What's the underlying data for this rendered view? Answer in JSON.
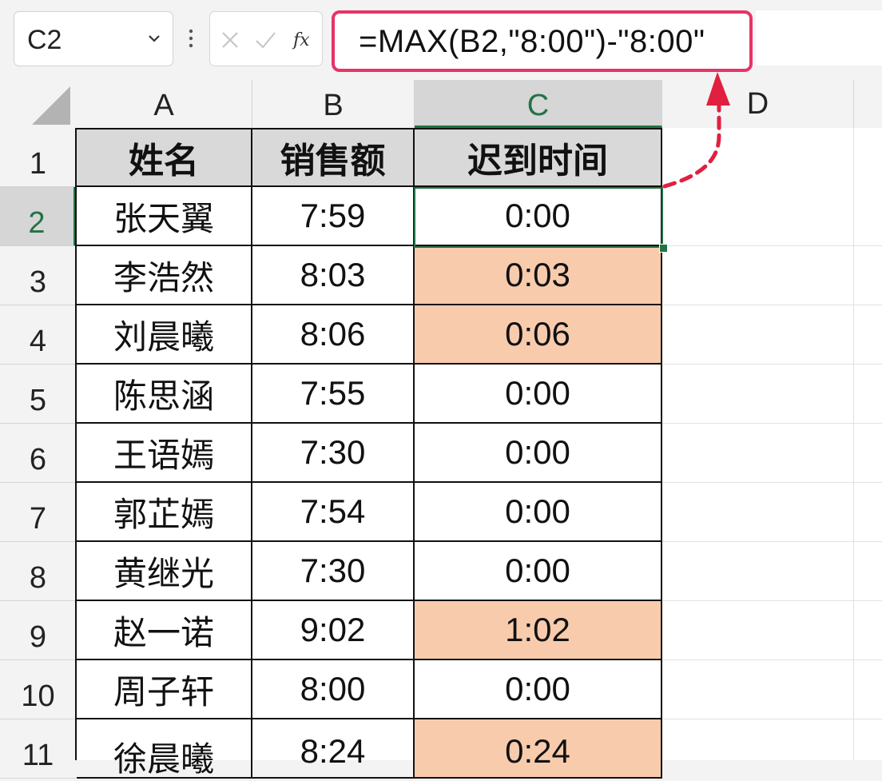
{
  "formula_bar": {
    "name_box": "C2",
    "formula": "=MAX(B2,\"8:00\")-\"8:00\""
  },
  "columns": [
    "A",
    "B",
    "C",
    "D"
  ],
  "rows": [
    "1",
    "2",
    "3",
    "4",
    "5",
    "6",
    "7",
    "8",
    "9",
    "10",
    "11"
  ],
  "table": {
    "headers": [
      "姓名",
      "销售额",
      "迟到时间"
    ],
    "rows": [
      {
        "name": "张天翼",
        "time": "7:59",
        "late": "0:00"
      },
      {
        "name": "李浩然",
        "time": "8:03",
        "late": "0:03"
      },
      {
        "name": "刘晨曦",
        "time": "8:06",
        "late": "0:06"
      },
      {
        "name": "陈思涵",
        "time": "7:55",
        "late": "0:00"
      },
      {
        "name": "王语嫣",
        "time": "7:30",
        "late": "0:00"
      },
      {
        "name": "郭芷嫣",
        "time": "7:54",
        "late": "0:00"
      },
      {
        "name": "黄继光",
        "time": "7:30",
        "late": "0:00"
      },
      {
        "name": "赵一诺",
        "time": "9:02",
        "late": "1:02"
      },
      {
        "name": "周子轩",
        "time": "8:00",
        "late": "0:00"
      },
      {
        "name": "徐晨曦",
        "time": "8:24",
        "late": "0:24"
      }
    ]
  },
  "colors": {
    "late_fill": "#f8cbad",
    "header_fill": "#d9d9d9",
    "selection": "#217346",
    "callout": "#e63467"
  }
}
